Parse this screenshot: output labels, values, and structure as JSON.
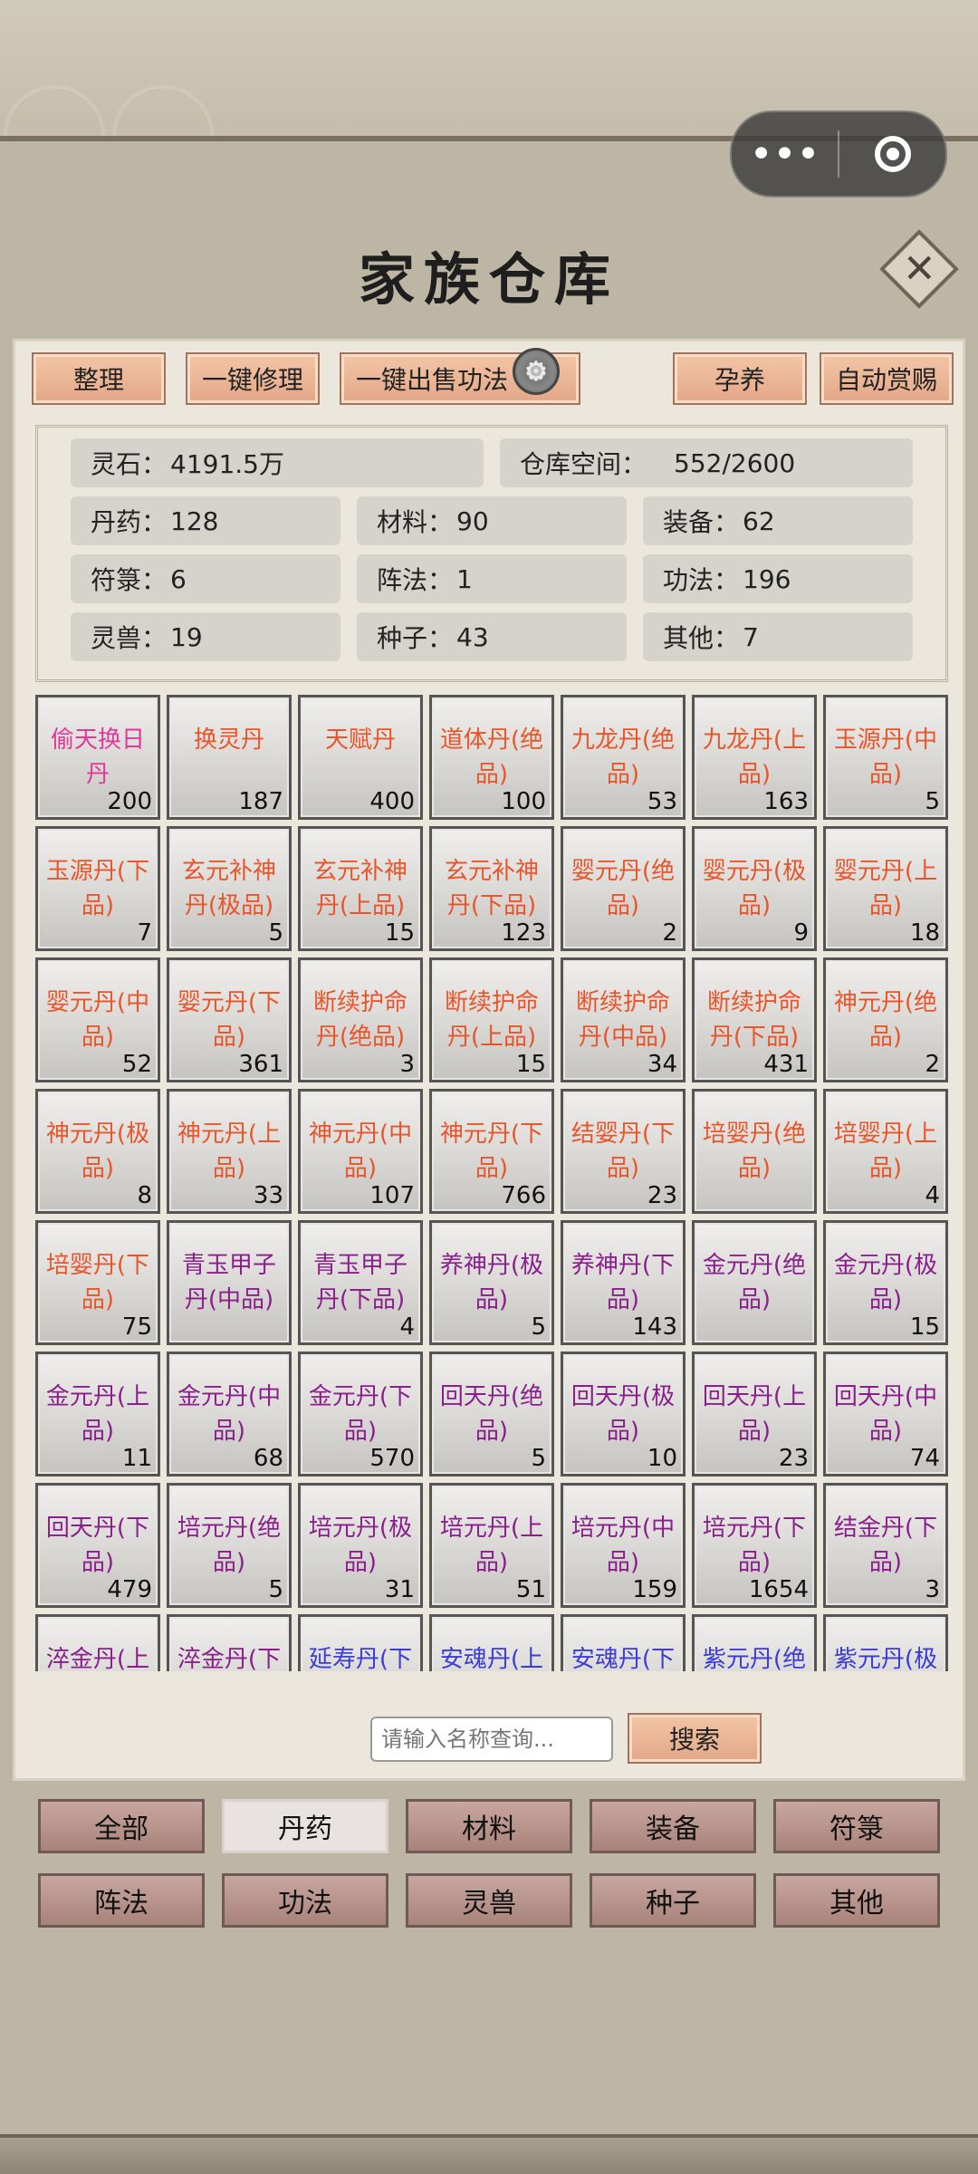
{
  "title": "家族仓库",
  "capsule": {
    "more_icon": "•••",
    "close_icon": "◎"
  },
  "toolbar": [
    {
      "label": "整理"
    },
    {
      "label": "一键修理"
    },
    {
      "label": "一键出售功法"
    },
    {
      "label": "孕养"
    },
    {
      "label": "自动赏赐"
    }
  ],
  "stats": {
    "lingshi": {
      "label": "灵石：",
      "value": "4191.5万"
    },
    "space": {
      "label": "仓库空间：",
      "value": "552/2600"
    },
    "danyao": {
      "label": "丹药：",
      "value": "128"
    },
    "cailiao": {
      "label": "材料：",
      "value": "90"
    },
    "zhuangbei": {
      "label": "装备：",
      "value": "62"
    },
    "fulu": {
      "label": "符箓：",
      "value": "6"
    },
    "zhenfa": {
      "label": "阵法：",
      "value": "1"
    },
    "gongfa": {
      "label": "功法：",
      "value": "196"
    },
    "lingshou": {
      "label": "灵兽：",
      "value": "19"
    },
    "zhongzi": {
      "label": "种子：",
      "value": "43"
    },
    "qita": {
      "label": "其他：",
      "value": "7"
    }
  },
  "colors": {
    "pink": "#e0379a",
    "orange": "#e8552a",
    "purple": "#8a1e8c",
    "blue": "#3b3bd6"
  },
  "items": [
    {
      "name": "偷天换日丹",
      "count": "200",
      "color": "pink"
    },
    {
      "name": "换灵丹",
      "count": "187",
      "color": "orange"
    },
    {
      "name": "天赋丹",
      "count": "400",
      "color": "orange"
    },
    {
      "name": "道体丹(绝品)",
      "count": "100",
      "color": "orange"
    },
    {
      "name": "九龙丹(绝品)",
      "count": "53",
      "color": "orange"
    },
    {
      "name": "九龙丹(上品)",
      "count": "163",
      "color": "orange"
    },
    {
      "name": "玉源丹(中品)",
      "count": "5",
      "color": "orange"
    },
    {
      "name": "玉源丹(下品)",
      "count": "7",
      "color": "orange"
    },
    {
      "name": "玄元补神丹(极品)",
      "count": "5",
      "color": "orange"
    },
    {
      "name": "玄元补神丹(上品)",
      "count": "15",
      "color": "orange"
    },
    {
      "name": "玄元补神丹(下品)",
      "count": "123",
      "color": "orange"
    },
    {
      "name": "婴元丹(绝品)",
      "count": "2",
      "color": "orange"
    },
    {
      "name": "婴元丹(极品)",
      "count": "9",
      "color": "orange"
    },
    {
      "name": "婴元丹(上品)",
      "count": "18",
      "color": "orange"
    },
    {
      "name": "婴元丹(中品)",
      "count": "52",
      "color": "orange"
    },
    {
      "name": "婴元丹(下品)",
      "count": "361",
      "color": "orange"
    },
    {
      "name": "断续护命丹(绝品)",
      "count": "3",
      "color": "orange"
    },
    {
      "name": "断续护命丹(上品)",
      "count": "15",
      "color": "orange"
    },
    {
      "name": "断续护命丹(中品)",
      "count": "34",
      "color": "orange"
    },
    {
      "name": "断续护命丹(下品)",
      "count": "431",
      "color": "orange"
    },
    {
      "name": "神元丹(绝品)",
      "count": "2",
      "color": "orange"
    },
    {
      "name": "神元丹(极品)",
      "count": "8",
      "color": "orange"
    },
    {
      "name": "神元丹(上品)",
      "count": "33",
      "color": "orange"
    },
    {
      "name": "神元丹(中品)",
      "count": "107",
      "color": "orange"
    },
    {
      "name": "神元丹(下品)",
      "count": "766",
      "color": "orange"
    },
    {
      "name": "结婴丹(下品)",
      "count": "23",
      "color": "orange"
    },
    {
      "name": "培婴丹(绝品)",
      "count": "",
      "color": "orange"
    },
    {
      "name": "培婴丹(上品)",
      "count": "4",
      "color": "orange"
    },
    {
      "name": "培婴丹(下品)",
      "count": "75",
      "color": "orange"
    },
    {
      "name": "青玉甲子丹(中品)",
      "count": "",
      "color": "purple"
    },
    {
      "name": "青玉甲子丹(下品)",
      "count": "4",
      "color": "purple"
    },
    {
      "name": "养神丹(极品)",
      "count": "5",
      "color": "purple"
    },
    {
      "name": "养神丹(下品)",
      "count": "143",
      "color": "purple"
    },
    {
      "name": "金元丹(绝品)",
      "count": "",
      "color": "purple"
    },
    {
      "name": "金元丹(极品)",
      "count": "15",
      "color": "purple"
    },
    {
      "name": "金元丹(上品)",
      "count": "11",
      "color": "purple"
    },
    {
      "name": "金元丹(中品)",
      "count": "68",
      "color": "purple"
    },
    {
      "name": "金元丹(下品)",
      "count": "570",
      "color": "purple"
    },
    {
      "name": "回天丹(绝品)",
      "count": "5",
      "color": "purple"
    },
    {
      "name": "回天丹(极品)",
      "count": "10",
      "color": "purple"
    },
    {
      "name": "回天丹(上品)",
      "count": "23",
      "color": "purple"
    },
    {
      "name": "回天丹(中品)",
      "count": "74",
      "color": "purple"
    },
    {
      "name": "回天丹(下品)",
      "count": "479",
      "color": "purple"
    },
    {
      "name": "培元丹(绝品)",
      "count": "5",
      "color": "purple"
    },
    {
      "name": "培元丹(极品)",
      "count": "31",
      "color": "purple"
    },
    {
      "name": "培元丹(上品)",
      "count": "51",
      "color": "purple"
    },
    {
      "name": "培元丹(中品)",
      "count": "159",
      "color": "purple"
    },
    {
      "name": "培元丹(下品)",
      "count": "1654",
      "color": "purple"
    },
    {
      "name": "结金丹(下品)",
      "count": "3",
      "color": "purple"
    },
    {
      "name": "淬金丹(上品)",
      "count": "",
      "color": "purple"
    },
    {
      "name": "淬金丹(下品)",
      "count": "",
      "color": "purple"
    },
    {
      "name": "延寿丹(下品)",
      "count": "",
      "color": "blue"
    },
    {
      "name": "安魂丹(上品)",
      "count": "",
      "color": "blue"
    },
    {
      "name": "安魂丹(下品)",
      "count": "",
      "color": "blue"
    },
    {
      "name": "紫元丹(绝品)",
      "count": "",
      "color": "blue"
    },
    {
      "name": "紫元丹(极品)",
      "count": "",
      "color": "blue"
    }
  ],
  "search": {
    "placeholder": "请输入名称查询...",
    "button": "搜索"
  },
  "tabs": [
    {
      "label": "全部"
    },
    {
      "label": "丹药"
    },
    {
      "label": "材料"
    },
    {
      "label": "装备"
    },
    {
      "label": "符箓"
    },
    {
      "label": "阵法"
    },
    {
      "label": "功法"
    },
    {
      "label": "灵兽"
    },
    {
      "label": "种子"
    },
    {
      "label": "其他"
    }
  ],
  "active_tab": "丹药"
}
